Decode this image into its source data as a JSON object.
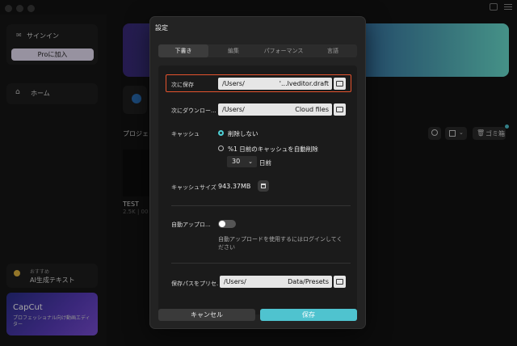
{
  "sidebar": {
    "signin_label": "サインイン",
    "pro_label": "Proに加入",
    "home_label": "ホーム",
    "promo_small": "おすすめ",
    "promo_title": "AI生成テキスト",
    "capcut_title": "CapCut",
    "capcut_sub": "プロフェッショナル向け動画エディター"
  },
  "main": {
    "projects_heading": "プロジェク",
    "project_name": "TEST",
    "project_meta": "2.5K | 00",
    "trash_label": "ゴミ箱"
  },
  "dialog": {
    "title": "設定",
    "tabs": [
      {
        "label": "下書き"
      },
      {
        "label": "編集"
      },
      {
        "label": "パフォーマンス"
      },
      {
        "label": "言語"
      }
    ],
    "save_to": {
      "label": "次に保存",
      "path_left": "/Users/",
      "path_right": "'...lveditor.draft"
    },
    "download_to": {
      "label": "次にダウンロー...",
      "path_left": "/Users/",
      "path_right": "Cloud files"
    },
    "cache": {
      "label": "キャッシュ",
      "option_keep": "削除しない",
      "option_auto": "%1 日前のキャッシュを自動削除",
      "days_value": "30",
      "days_unit": "日前"
    },
    "cache_size": {
      "label": "キャッシュサイズ",
      "value": "943.37MB"
    },
    "auto_upload": {
      "label": "自動アップロ...",
      "hint": "自動アップロードを使用するにはログインしてください",
      "enabled": false
    },
    "preset_path": {
      "label": "保存パスをプリセ...",
      "path_left": "/Users/",
      "path_right": "Data/Presets"
    },
    "cancel_label": "キャンセル",
    "save_label": "保存"
  },
  "colors": {
    "accent": "#4fc3cf",
    "highlight_border": "#e5532e",
    "pro_button": "#e9e0f6"
  }
}
